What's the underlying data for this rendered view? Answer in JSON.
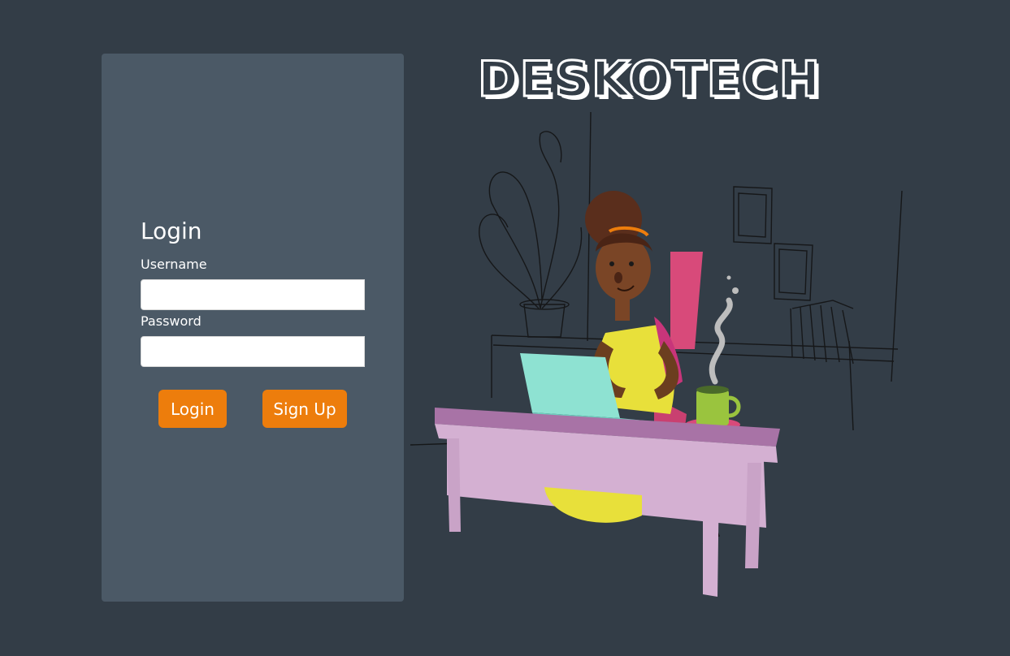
{
  "brand": {
    "name": "DESKOTECH"
  },
  "login": {
    "title": "Login",
    "username_label": "Username",
    "username_value": "",
    "password_label": "Password",
    "password_value": "",
    "login_button": "Login",
    "signup_button": "Sign Up"
  },
  "colors": {
    "background": "#333d47",
    "panel": "#4b5966",
    "accent": "#ed7d0c",
    "text": "#ffffff"
  },
  "illustration": {
    "icon": "woman-working-at-desk-illustration"
  }
}
